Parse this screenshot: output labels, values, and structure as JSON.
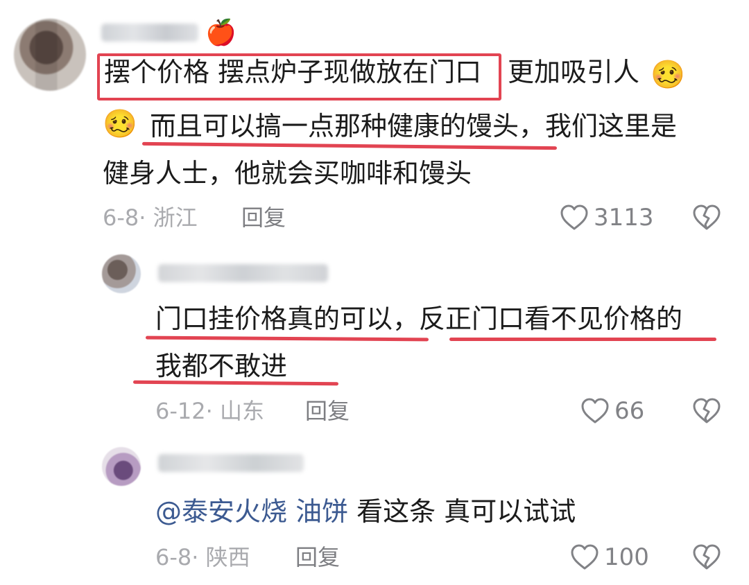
{
  "comment_main": {
    "text_highlighted": "摆个价格 摆点炉子现做放在门口",
    "text_after": "更加吸引人",
    "emoji_1": "🥴",
    "emoji_2": "🥴",
    "line_2": "而且可以搞一点那种健康的馒头，我们这里是",
    "line_3": "健身人士，他就会买咖啡和馒头",
    "meta": "6-8· 浙江",
    "reply_label": "回复",
    "likes": "3113",
    "badge_icon": "apple-icon"
  },
  "reply_1": {
    "line_1": "门口挂价格真的可以，反正门口看不见价格的",
    "line_2": "我都不敢进",
    "meta": "6-12· 山东",
    "reply_label": "回复",
    "likes": "66"
  },
  "reply_2": {
    "mention": "@泰安火烧 油饼",
    "text": " 看这条 真可以试试",
    "meta": "6-8· 陕西",
    "reply_label": "回复",
    "likes": "100"
  },
  "colors": {
    "highlight_red": "#e24452",
    "mention_blue": "#3c5a91",
    "meta_gray": "#a9aaae"
  }
}
